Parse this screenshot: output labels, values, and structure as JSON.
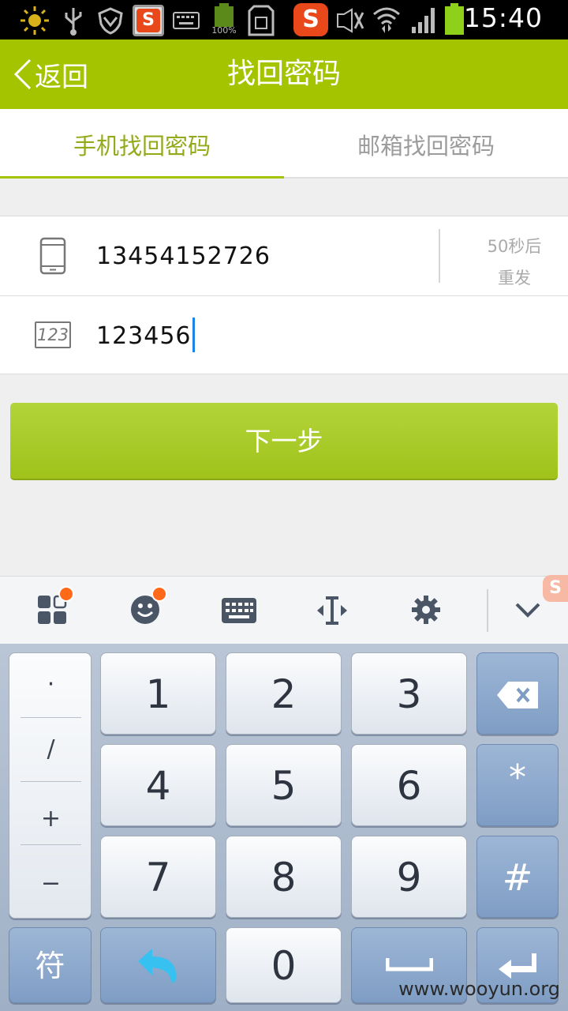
{
  "status_bar": {
    "time": "15:40",
    "battery_text": "100%",
    "sogou_badge": "S",
    "icons": [
      "sun-icon",
      "usb-icon",
      "shield-icon",
      "sogou-app-icon",
      "keyboard-icon",
      "battery-small-icon",
      "sdcard-icon",
      "sogou-input-icon",
      "mute-icon",
      "wifi-icon",
      "signal-icon",
      "battery-icon"
    ]
  },
  "header": {
    "back_label": "返回",
    "title": "找回密码"
  },
  "tabs": [
    {
      "label": "手机找回密码",
      "active": true
    },
    {
      "label": "邮箱找回密码",
      "active": false
    }
  ],
  "form": {
    "phone": {
      "icon": "phone-icon",
      "value": "13454152726"
    },
    "resend": {
      "line1": "50秒后",
      "line2": "重发"
    },
    "code": {
      "icon": "numeric-123-icon",
      "icon_text": "123",
      "value": "123456"
    }
  },
  "next_button": {
    "label": "下一步"
  },
  "keyboard_toolbar": {
    "items": [
      "apps-grid-icon",
      "emoji-icon",
      "keyboard-switch-icon",
      "cursor-move-icon",
      "settings-icon",
      "collapse-chevron-icon"
    ]
  },
  "keyboard": {
    "symbols": [
      "·",
      "/",
      "+",
      "−"
    ],
    "digits": [
      "1",
      "2",
      "3",
      "4",
      "5",
      "6",
      "7",
      "8",
      "9",
      "0"
    ],
    "star": "*",
    "hash": "#",
    "symbol_key": "符"
  },
  "watermark": "www.wooyun.org",
  "colors": {
    "accent": "#a4c400",
    "tab_active": "#93ab1a",
    "cursor": "#1b84e8"
  }
}
